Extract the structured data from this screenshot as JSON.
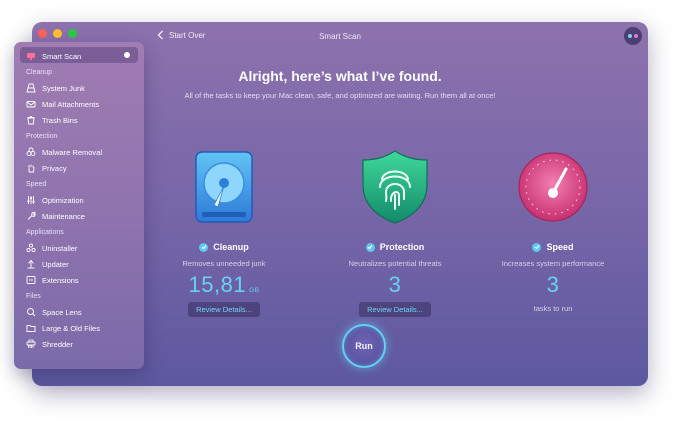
{
  "window": {
    "title": "Smart Scan",
    "back_label": "Start Over",
    "traffic_colors": [
      "#fe5f57",
      "#febc2e",
      "#28c840"
    ]
  },
  "main": {
    "headline": "Alright, here’s what I’ve found.",
    "subline": "All of the tasks to keep your Mac clean, safe, and optimized are waiting. Run them all at once!",
    "cards": [
      {
        "icon": "hard-drive-icon",
        "title": "Cleanup",
        "desc": "Removes unneeded junk",
        "value": "15,81",
        "unit": "GB",
        "review": "Review Details..."
      },
      {
        "icon": "fingerprint-shield-icon",
        "title": "Protection",
        "desc": "Neutralizes potential threats",
        "value": "3",
        "review": "Review Details..."
      },
      {
        "icon": "speedometer-icon",
        "title": "Speed",
        "desc": "Increases system performance",
        "value": "3",
        "note": "tasks to run"
      }
    ],
    "run_label": "Run"
  },
  "sidebar": {
    "active": "Smart Scan",
    "top_item": "Smart Scan",
    "sections": [
      {
        "header": "Cleanup",
        "items": [
          "System Junk",
          "Mail Attachments",
          "Trash Bins"
        ]
      },
      {
        "header": "Protection",
        "items": [
          "Malware Removal",
          "Privacy"
        ]
      },
      {
        "header": "Speed",
        "items": [
          "Optimization",
          "Maintenance"
        ]
      },
      {
        "header": "Applications",
        "items": [
          "Uninstaller",
          "Updater",
          "Extensions"
        ]
      },
      {
        "header": "Files",
        "items": [
          "Space Lens",
          "Large & Old Files",
          "Shredder"
        ]
      }
    ]
  },
  "colors": {
    "accent": "#62d2f4",
    "value_blue": "#68d0f5"
  }
}
